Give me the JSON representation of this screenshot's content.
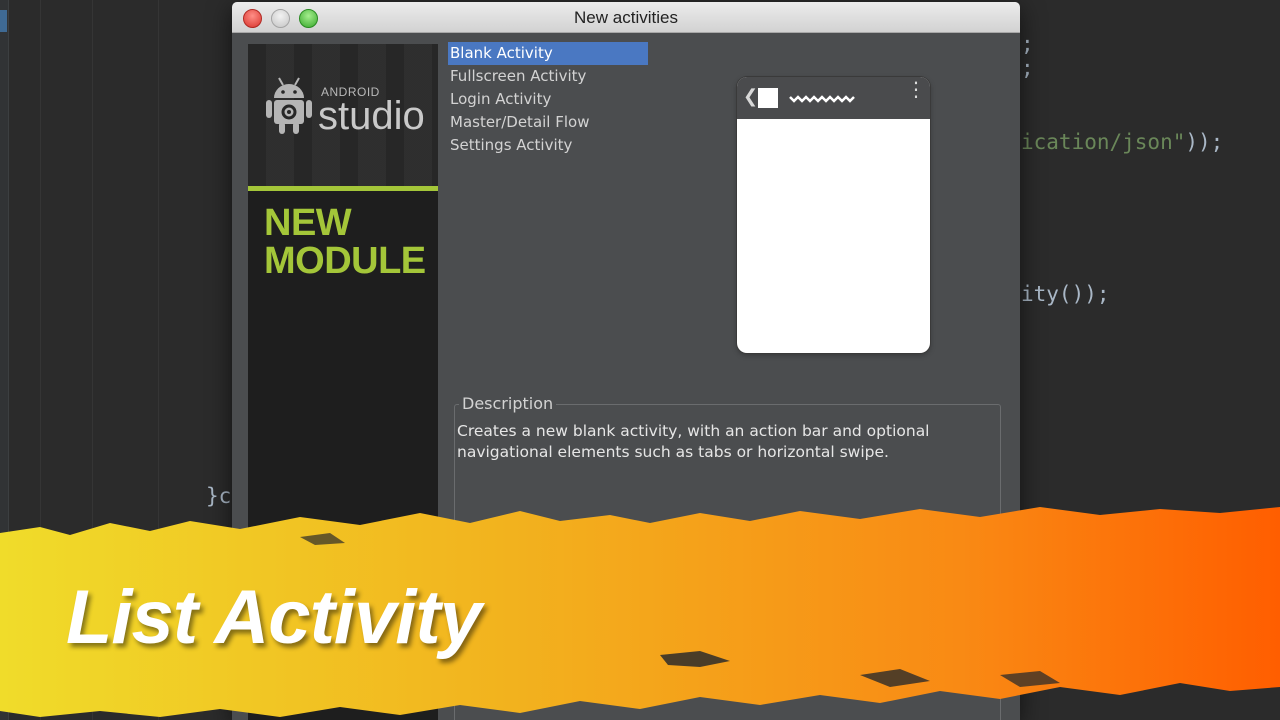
{
  "dialog": {
    "title": "New activities"
  },
  "banner": {
    "brand_small": "ANDROID",
    "brand_big": "studio",
    "module_line1": "NEW",
    "module_line2": "MODULE"
  },
  "activities": [
    {
      "label": "Blank Activity",
      "selected": true
    },
    {
      "label": "Fullscreen Activity",
      "selected": false
    },
    {
      "label": "Login Activity",
      "selected": false
    },
    {
      "label": "Master/Detail Flow",
      "selected": false
    },
    {
      "label": "Settings Activity",
      "selected": false
    }
  ],
  "preview": {
    "back_glyph": "❮",
    "menu_glyph": "⋮"
  },
  "description": {
    "legend": "Description",
    "text": "Creates a new blank activity, with an action bar and optional navigational elements such as tabs or horizontal swipe."
  },
  "code_fragments": {
    "line1": ";",
    "line2": ";",
    "line3_str": "ication/json\"",
    "line3_end": "));",
    "line4": "ity());",
    "line5": "}c"
  },
  "overlay": {
    "title": "List Activity"
  },
  "colors": {
    "accent_green": "#a4c639",
    "selection_blue": "#4a78c2",
    "banner_orange": "#ff6a00",
    "banner_yellow": "#f0d020"
  }
}
